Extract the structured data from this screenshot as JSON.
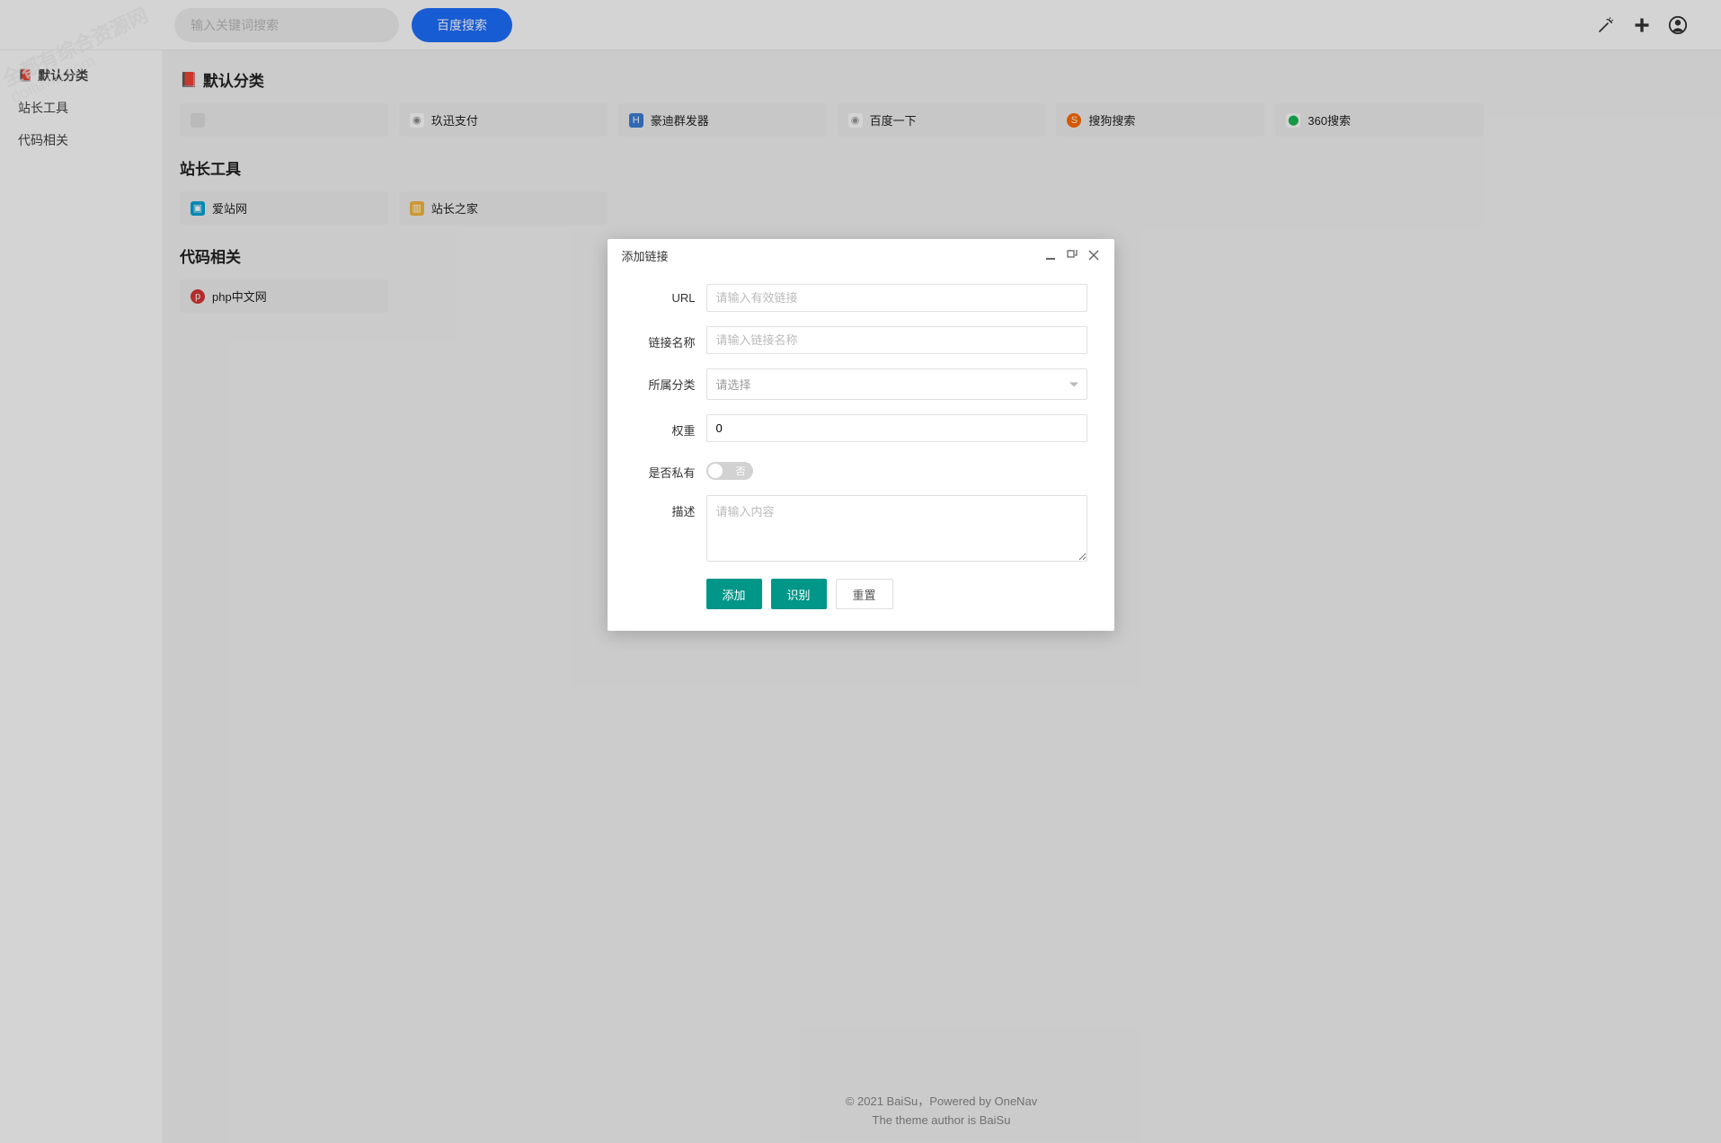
{
  "watermark": {
    "line1": "全都有综合资源网",
    "line2": "doituvip.com"
  },
  "header": {
    "search_placeholder": "输入关键词搜索",
    "search_btn": "百度搜索"
  },
  "sidebar": {
    "items": [
      {
        "label": "默认分类"
      },
      {
        "label": "站长工具"
      },
      {
        "label": "代码相关"
      }
    ]
  },
  "sections": [
    {
      "title": "默认分类",
      "cards": [
        {
          "label": "",
          "icon_bg": "#e0e0e0"
        },
        {
          "label": "玖迅支付",
          "icon_bg": "#888"
        },
        {
          "label": "豪迪群发器",
          "icon_bg": "#3b7dd8"
        },
        {
          "label": "百度一下",
          "icon_bg": "#999"
        },
        {
          "label": "搜狗搜索",
          "icon_bg": "#ff6a00"
        },
        {
          "label": "360搜索",
          "icon_bg": "#19b955"
        }
      ]
    },
    {
      "title": "站长工具",
      "cards": [
        {
          "label": "爱站网",
          "icon_bg": "#04a3d9"
        },
        {
          "label": "站长之家",
          "icon_bg": "#f6b73c"
        }
      ]
    },
    {
      "title": "代码相关",
      "cards": [
        {
          "label": "php中文网",
          "icon_bg": "#d73535"
        }
      ]
    }
  ],
  "footer": {
    "line1": "© 2021 BaiSu，Powered by OneNav",
    "line2": "The theme author is BaiSu"
  },
  "modal": {
    "title": "添加链接",
    "fields": {
      "url_label": "URL",
      "url_placeholder": "请输入有效链接",
      "name_label": "链接名称",
      "name_placeholder": "请输入链接名称",
      "category_label": "所属分类",
      "category_placeholder": "请选择",
      "weight_label": "权重",
      "weight_value": "0",
      "private_label": "是否私有",
      "private_state": "否",
      "desc_label": "描述",
      "desc_placeholder": "请输入内容"
    },
    "buttons": {
      "add": "添加",
      "identify": "识别",
      "reset": "重置"
    }
  }
}
